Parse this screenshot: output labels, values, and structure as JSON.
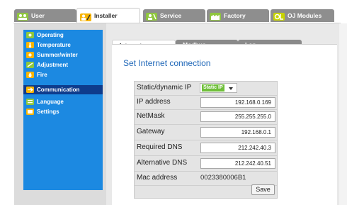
{
  "top_tabs": [
    {
      "label": "User",
      "icon": "user-icon",
      "color": "#8fc63e"
    },
    {
      "label": "Installer",
      "icon": "installer-icon",
      "color": "#f7b400"
    },
    {
      "label": "Service",
      "icon": "service-icon",
      "color": "#8fc63e"
    },
    {
      "label": "Factory",
      "icon": "factory-icon",
      "color": "#8fc63e"
    },
    {
      "label": "OJ Modules",
      "icon": "modules-icon",
      "color": "#c8d400"
    }
  ],
  "active_top_tab": "Installer",
  "sidebar": {
    "items": [
      {
        "label": "Operating",
        "icon": "operating-icon",
        "icon_color": "#8fc63e"
      },
      {
        "label": "Temperature",
        "icon": "thermometer-icon",
        "icon_color": "#f7b400"
      },
      {
        "label": "Summer/winter",
        "icon": "sun-icon",
        "icon_color": "#f7b400"
      },
      {
        "label": "Adjustment",
        "icon": "adjustment-icon",
        "icon_color": "#8fc63e"
      },
      {
        "label": "Fire",
        "icon": "fire-icon",
        "icon_color": "#f7b400"
      },
      {
        "label": "Communication",
        "icon": "communication-icon",
        "icon_color": "#f7b400"
      },
      {
        "label": "Language",
        "icon": "language-icon",
        "icon_color": "#8fc63e"
      },
      {
        "label": "Settings",
        "icon": "settings-icon",
        "icon_color": "#f7b400"
      }
    ],
    "active": "Communication",
    "color": "#1c89e1",
    "active_color": "#0e3c8c"
  },
  "sub_tabs": [
    "Internet",
    "Modbus",
    "Lon"
  ],
  "active_sub_tab": "Internet",
  "heading": "Set Internet connection",
  "form": {
    "ip_mode": {
      "label": "Static/dynamic IP",
      "value": "Static IP"
    },
    "ip_address": {
      "label": "IP address",
      "value": "192.168.0.169"
    },
    "netmask": {
      "label": "NetMask",
      "value": "255.255.255.0"
    },
    "gateway": {
      "label": "Gateway",
      "value": "192.168.0.1"
    },
    "required_dns": {
      "label": "Required DNS",
      "value": "212.242.40.3"
    },
    "alternative_dns": {
      "label": "Alternative DNS",
      "value": "212.242.40.51"
    },
    "mac_address": {
      "label": "Mac address",
      "value": "0023380006B1"
    },
    "save_label": "Save"
  }
}
